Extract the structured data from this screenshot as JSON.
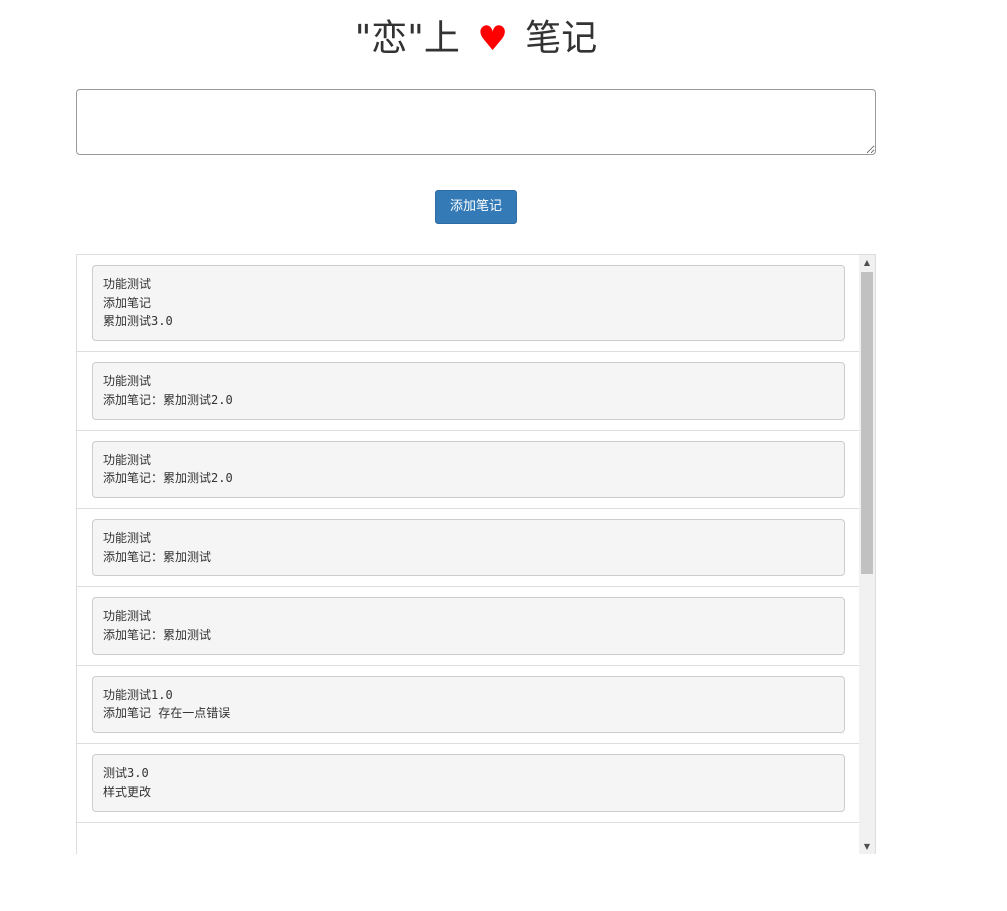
{
  "header": {
    "title_prefix": "\"恋\"上",
    "heart": "♥",
    "title_suffix": "笔记"
  },
  "editor": {
    "value": "",
    "placeholder": ""
  },
  "toolbar": {
    "add_label": "添加笔记"
  },
  "notes": [
    {
      "text": "功能测试\n添加笔记\n累加测试3.0"
    },
    {
      "text": "功能测试\n添加笔记：累加测试2.0"
    },
    {
      "text": "功能测试\n添加笔记：累加测试2.0"
    },
    {
      "text": "功能测试\n添加笔记：累加测试"
    },
    {
      "text": "功能测试\n添加笔记：累加测试"
    },
    {
      "text": "功能测试1.0\n添加笔记 存在一点错误"
    },
    {
      "text": "测试3.0\n样式更改"
    }
  ],
  "colors": {
    "accent": "#337ab7",
    "heart": "#ff0000"
  }
}
